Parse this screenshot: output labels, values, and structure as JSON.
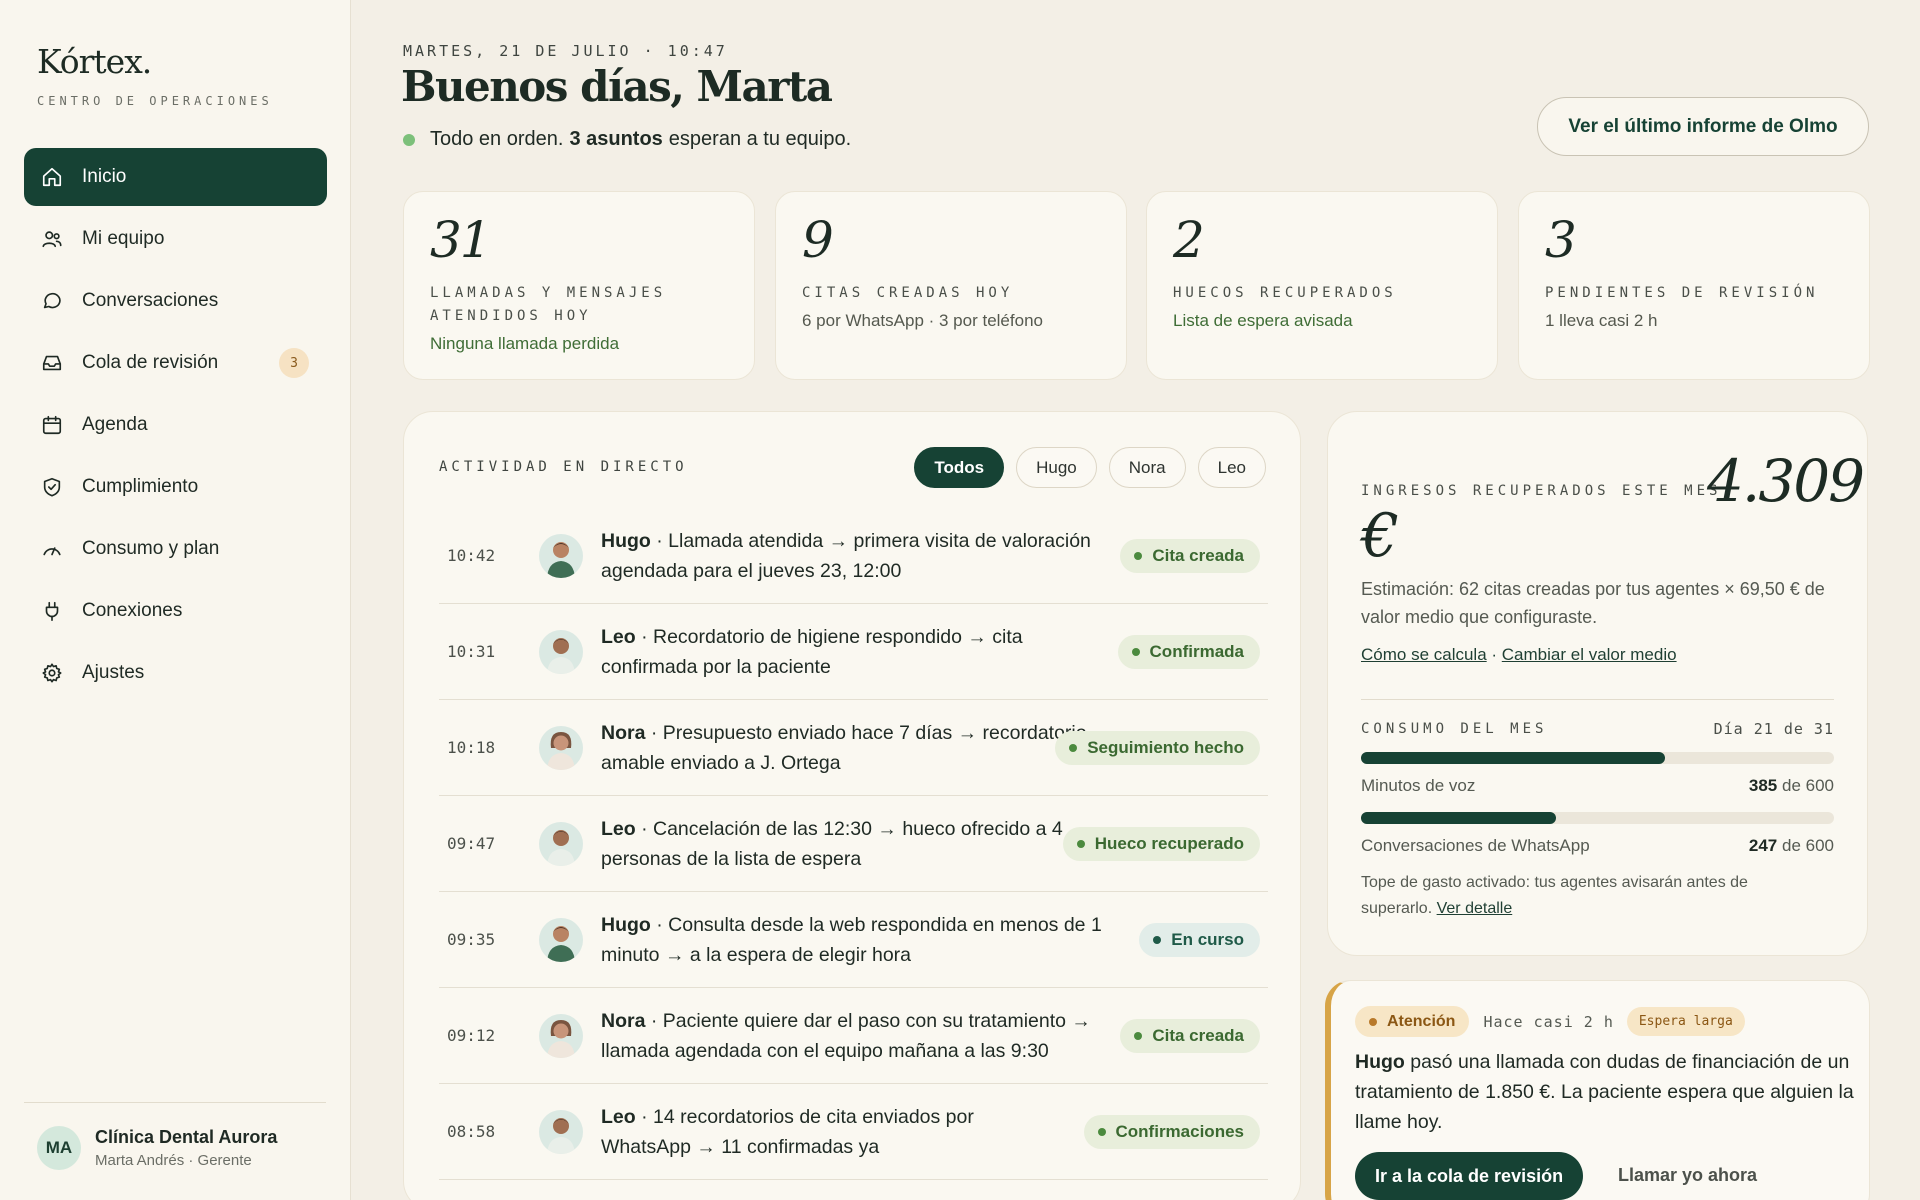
{
  "sidebar": {
    "brand": "Kórtex.",
    "brand_subtitle": "CENTRO DE OPERACIONES",
    "items": [
      {
        "label": "Inicio",
        "icon": "home-icon"
      },
      {
        "label": "Mi equipo",
        "icon": "users-icon"
      },
      {
        "label": "Conversaciones",
        "icon": "chat-icon"
      },
      {
        "label": "Cola de revisión",
        "icon": "inbox-icon",
        "badge": "3"
      },
      {
        "label": "Agenda",
        "icon": "calendar-icon"
      },
      {
        "label": "Cumplimiento",
        "icon": "shield-check-icon"
      },
      {
        "label": "Consumo y plan",
        "icon": "gauge-icon"
      },
      {
        "label": "Conexiones",
        "icon": "plug-icon"
      },
      {
        "label": "Ajustes",
        "icon": "gear-icon"
      }
    ],
    "account": {
      "initials": "MA",
      "name": "Clínica Dental Aurora",
      "role": "Marta Andrés · Gerente"
    }
  },
  "header": {
    "date": "MARTES, 21 DE JULIO · 10:47",
    "greeting": "Buenos días, Marta",
    "status_prefix": "Todo en orden.",
    "status_bold": "3 asuntos",
    "status_suffix": "esperan a tu equipo.",
    "report_button": "Ver el último informe de Olmo"
  },
  "stats": [
    {
      "value": "31",
      "label": "LLAMADAS Y MENSAJES ATENDIDOS HOY",
      "note": "Ninguna llamada perdida"
    },
    {
      "value": "9",
      "label": "CITAS CREADAS HOY",
      "note": "6 por WhatsApp · 3 por teléfono"
    },
    {
      "value": "2",
      "label": "HUECOS RECUPERADOS",
      "note": "Lista de espera avisada"
    },
    {
      "value": "3",
      "label": "PENDIENTES DE REVISIÓN",
      "note": "1 lleva casi 2 h"
    }
  ],
  "activity": {
    "title": "ACTIVIDAD EN DIRECTO",
    "filters": [
      "Todos",
      "Hugo",
      "Nora",
      "Leo"
    ],
    "rows": [
      {
        "time": "10:42",
        "agent": "Hugo",
        "text": " · Llamada atendida → primera visita de valoración agendada para el jueves 23, 12:00",
        "status": "Cita creada"
      },
      {
        "time": "10:31",
        "agent": "Leo",
        "text": " · Recordatorio de higiene respondido → cita confirmada por la paciente",
        "status": "Confirmada"
      },
      {
        "time": "10:18",
        "agent": "Nora",
        "text": " · Presupuesto enviado hace 7 días → recordatorio amable enviado a J. Ortega",
        "status": "Seguimiento hecho"
      },
      {
        "time": "09:47",
        "agent": "Leo",
        "text": " · Cancelación de las 12:30 → hueco ofrecido a 4 personas de la lista de espera",
        "status": "Hueco recuperado"
      },
      {
        "time": "09:35",
        "agent": "Hugo",
        "text": " · Consulta desde la web respondida en menos de 1 minuto → a la espera de elegir hora",
        "status": "En curso"
      },
      {
        "time": "09:12",
        "agent": "Nora",
        "text": " · Paciente quiere dar el paso con su tratamiento → llamada agendada con el equipo mañana a las 9:30",
        "status": "Cita creada"
      },
      {
        "time": "08:58",
        "agent": "Leo",
        "text": " · 14 recordatorios de cita enviados por WhatsApp → 11 confirmadas ya",
        "status": "Confirmaciones"
      }
    ]
  },
  "revenue": {
    "label": "INGRESOS RECUPERADOS ESTE MES",
    "value": "4.309",
    "currency": "€",
    "description": "Estimación: 62 citas creadas por tus agentes × 69,50 € de valor medio que configuraste.",
    "link_how": "Cómo se calcula",
    "link_sep": " · ",
    "link_change": "Cambiar el valor medio"
  },
  "usage": {
    "title": "CONSUMO DEL MES",
    "day": "Día 21 de 31",
    "items": [
      {
        "name": "Minutos de voz",
        "used": "385",
        "of": " de 600",
        "fraction": 0.642
      },
      {
        "name": "Conversaciones de WhatsApp",
        "used": "247",
        "of": " de 600",
        "fraction": 0.412
      }
    ],
    "note": "Tope de gasto activado: tus agentes avisarán antes de superarlo.",
    "note_link": "Ver detalle"
  },
  "alert": {
    "tag": "Atención",
    "time": "Hace casi 2 h",
    "wait": "Espera larga",
    "agent": "Hugo",
    "text": " pasó una llamada con dudas de financiación de un tratamiento de 1.850 €. La paciente espera que alguien la llame hoy.",
    "primary": "Ir a la cola de revisión",
    "secondary": "Llamar yo ahora"
  },
  "colors": {
    "accent": "#164234",
    "ok": "#7cc07a",
    "warning": "#d7a447"
  }
}
